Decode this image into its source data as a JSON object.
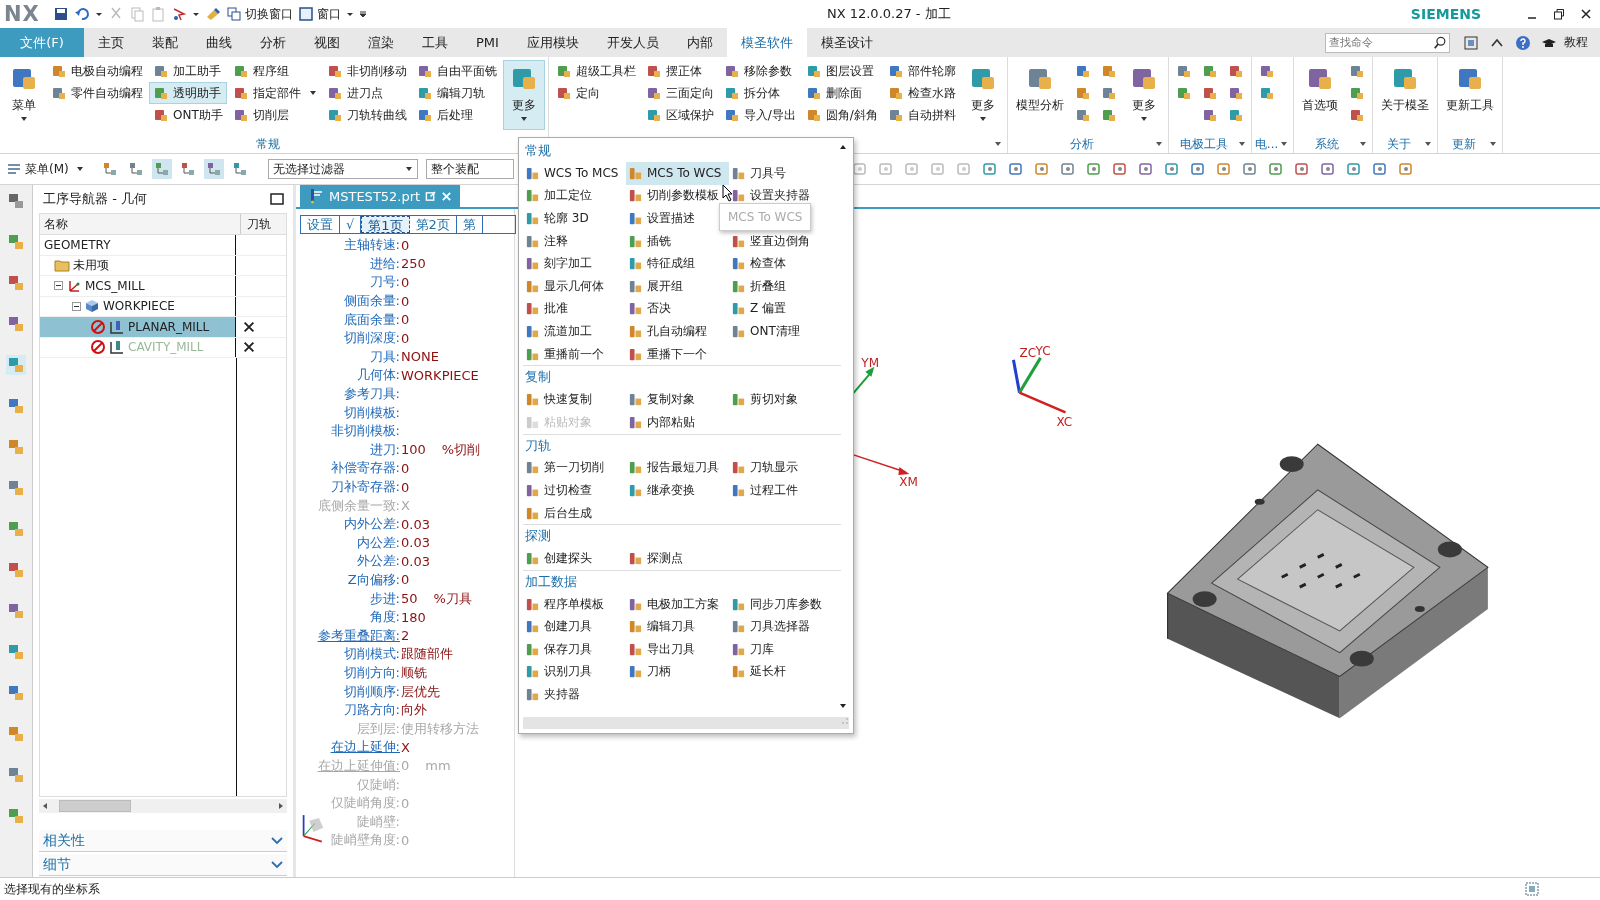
{
  "titlebar": {
    "logo": "NX",
    "quick": [
      "切换窗口",
      "窗口"
    ],
    "title": "NX 12.0.0.27 - 加工",
    "brand": "SIEMENS"
  },
  "tabs": {
    "file": "文件(F)",
    "items": [
      {
        "label": "主页",
        "selected": false
      },
      {
        "label": "装配",
        "selected": false
      },
      {
        "label": "曲线",
        "selected": false
      },
      {
        "label": "分析",
        "selected": false
      },
      {
        "label": "视图",
        "selected": false
      },
      {
        "label": "渲染",
        "selected": false
      },
      {
        "label": "工具",
        "selected": false
      },
      {
        "label": "PMI",
        "selected": false
      },
      {
        "label": "应用模块",
        "selected": false
      },
      {
        "label": "开发人员",
        "selected": false
      },
      {
        "label": "内部",
        "selected": false
      },
      {
        "label": "模圣软件",
        "selected": true
      },
      {
        "label": "模圣设计",
        "selected": false
      }
    ],
    "search": {
      "placeholder": "查找命令"
    },
    "help": "教程"
  },
  "ribbon": {
    "groups": [
      {
        "label": "常规",
        "launcher": false,
        "controls": [
          {
            "kind": "big",
            "label": "菜单",
            "dropdown": true,
            "pressed": false
          },
          {
            "kind": "stack",
            "items": [
              {
                "label": "电极自动编程",
                "highlighted": false,
                "dropdown": false
              },
              {
                "label": "零件自动编程",
                "highlighted": false,
                "dropdown": false
              }
            ]
          },
          {
            "kind": "stack",
            "items": [
              {
                "label": "加工助手",
                "highlighted": false,
                "dropdown": false
              },
              {
                "label": "透明助手",
                "highlighted": true,
                "dropdown": false
              },
              {
                "label": "ONT助手",
                "highlighted": false,
                "dropdown": false
              }
            ]
          },
          {
            "kind": "stack",
            "items": [
              {
                "label": "程序组",
                "highlighted": false,
                "dropdown": false
              },
              {
                "label": "指定部件",
                "highlighted": false,
                "dropdown": true
              },
              {
                "label": "切削层",
                "highlighted": false,
                "dropdown": false
              }
            ]
          },
          {
            "kind": "stack",
            "items": [
              {
                "label": "非切削移动",
                "highlighted": false,
                "dropdown": false
              },
              {
                "label": "进刀点",
                "highlighted": false,
                "dropdown": false
              },
              {
                "label": "刀轨转曲线",
                "highlighted": false,
                "dropdown": false
              }
            ]
          },
          {
            "kind": "stack",
            "items": [
              {
                "label": "自由平面铣",
                "highlighted": false,
                "dropdown": false
              },
              {
                "label": "编辑刀轨",
                "highlighted": false,
                "dropdown": false
              },
              {
                "label": "后处理",
                "highlighted": false,
                "dropdown": false
              }
            ]
          },
          {
            "kind": "big",
            "label": "更多",
            "dropdown": true,
            "pressed": true
          }
        ]
      },
      {
        "launcher": true,
        "controls": [
          {
            "kind": "stack",
            "items": [
              {
                "label": "超级工具栏",
                "highlighted": false,
                "dropdown": false
              },
              {
                "label": "定向",
                "highlighted": false,
                "dropdown": false
              }
            ]
          },
          {
            "kind": "stack",
            "items": [
              {
                "label": "摆正体",
                "highlighted": false,
                "dropdown": false
              },
              {
                "label": "三面定向",
                "highlighted": false,
                "dropdown": false
              },
              {
                "label": "区域保护",
                "highlighted": false,
                "dropdown": false
              }
            ]
          },
          {
            "kind": "stack",
            "items": [
              {
                "label": "移除参数",
                "highlighted": false,
                "dropdown": false
              },
              {
                "label": "拆分体",
                "highlighted": false,
                "dropdown": false
              },
              {
                "label": "导入/导出",
                "highlighted": false,
                "dropdown": false
              }
            ]
          },
          {
            "kind": "stack",
            "items": [
              {
                "label": "图层设置",
                "highlighted": false,
                "dropdown": false
              },
              {
                "label": "删除面",
                "highlighted": false,
                "dropdown": false
              },
              {
                "label": "圆角/斜角",
                "highlighted": false,
                "dropdown": false
              }
            ]
          },
          {
            "kind": "stack",
            "items": [
              {
                "label": "部件轮廓",
                "highlighted": false,
                "dropdown": false
              },
              {
                "label": "检查水路",
                "highlighted": false,
                "dropdown": false
              },
              {
                "label": "自动拼料",
                "highlighted": false,
                "dropdown": false
              }
            ]
          },
          {
            "kind": "big",
            "label": "更多",
            "dropdown": true,
            "pressed": false
          }
        ]
      },
      {
        "label": "分析",
        "launcher": true,
        "controls": [
          {
            "kind": "big",
            "label": "模型分析",
            "dropdown": false,
            "pressed": false
          },
          {
            "kind": "stack",
            "items": [
              {
                "highlighted": false,
                "dropdown": false
              },
              {
                "highlighted": false,
                "dropdown": false
              },
              {
                "highlighted": false,
                "dropdown": false
              }
            ]
          },
          {
            "kind": "stack",
            "items": [
              {
                "highlighted": false,
                "dropdown": false
              },
              {
                "highlighted": false,
                "dropdown": false
              },
              {
                "highlighted": false,
                "dropdown": false
              }
            ]
          },
          {
            "kind": "big",
            "label": "更多",
            "dropdown": true,
            "pressed": false
          }
        ]
      },
      {
        "label": "电极工具",
        "launcher": true,
        "controls": [
          {
            "kind": "stack",
            "items": [
              {
                "highlighted": false,
                "dropdown": false
              },
              {
                "highlighted": false,
                "dropdown": false
              }
            ]
          },
          {
            "kind": "stack",
            "items": [
              {
                "highlighted": false,
                "dropdown": false
              },
              {
                "highlighted": false,
                "dropdown": false
              },
              {
                "highlighted": false,
                "dropdown": false
              }
            ]
          },
          {
            "kind": "stack",
            "items": [
              {
                "highlighted": false,
                "dropdown": false
              },
              {
                "highlighted": false,
                "dropdown": false
              },
              {
                "highlighted": false,
                "dropdown": false
              }
            ]
          }
        ]
      },
      {
        "label": "电...",
        "launcher": true,
        "controls": [
          {
            "kind": "stack",
            "items": [
              {
                "highlighted": false,
                "dropdown": false
              },
              {
                "highlighted": false,
                "dropdown": false
              }
            ]
          }
        ]
      },
      {
        "label": "系统",
        "launcher": true,
        "controls": [
          {
            "kind": "big",
            "label": "首选项",
            "dropdown": false,
            "pressed": false
          },
          {
            "kind": "stack",
            "items": [
              {
                "highlighted": false,
                "dropdown": false
              },
              {
                "highlighted": false,
                "dropdown": false
              },
              {
                "highlighted": false,
                "dropdown": false
              }
            ]
          }
        ]
      },
      {
        "label": "关于",
        "launcher": true,
        "controls": [
          {
            "kind": "big",
            "label": "关于模圣",
            "dropdown": false,
            "pressed": false
          }
        ]
      },
      {
        "label": "更新",
        "launcher": true,
        "controls": [
          {
            "kind": "big",
            "label": "更新工具",
            "dropdown": false,
            "pressed": false
          }
        ]
      }
    ]
  },
  "toolbar": {
    "menu": "菜单(M)",
    "filter": "无选择过滤器",
    "scope": "整个装配"
  },
  "navigator": {
    "title": "工序导航器 - 几何",
    "columns": [
      "名称",
      "刀轨"
    ],
    "root": "GEOMETRY",
    "tree": [
      {
        "label": "未用项",
        "kind": "folder",
        "selected": false,
        "dimmed": false
      },
      {
        "label": "MCS_MILL",
        "kind": "mcs",
        "selected": false,
        "dimmed": false,
        "expanded": true,
        "children": [
          {
            "label": "WORKPIECE",
            "kind": "workpiece",
            "selected": false,
            "dimmed": false,
            "expanded": true,
            "children": [
              {
                "label": "PLANAR_MILL",
                "kind": "operation",
                "selected": true,
                "dimmed": false,
                "toolpath_ok": false
              },
              {
                "label": "CAVITY_MILL",
                "kind": "operation",
                "selected": false,
                "dimmed": true,
                "toolpath_ok": false
              }
            ]
          }
        ]
      }
    ],
    "sections": [
      "相关性",
      "细节"
    ]
  },
  "part_tab": {
    "label": "MSTEST52.prt"
  },
  "params": {
    "tabs": [
      {
        "label": "设置",
        "selected": false
      },
      {
        "label": "√",
        "selected": false
      },
      {
        "label": "第1页",
        "selected": true
      },
      {
        "label": "第2页",
        "selected": false
      },
      {
        "label": "第",
        "selected": false
      }
    ],
    "rows": [
      {
        "label": "主轴转速:",
        "value": "0",
        "disabled": false,
        "link": false
      },
      {
        "label": "进给:",
        "value": "250",
        "disabled": false,
        "link": false
      },
      {
        "label": "刀号:",
        "value": "0",
        "disabled": false,
        "link": false
      },
      {
        "label": "侧面余量:",
        "value": "0",
        "disabled": false,
        "link": false
      },
      {
        "label": "底面余量:",
        "value": "0",
        "disabled": false,
        "link": false
      },
      {
        "label": "切削深度:",
        "value": "0",
        "disabled": false,
        "link": false
      },
      {
        "label": "刀具:",
        "value": "NONE",
        "disabled": false,
        "link": false
      },
      {
        "label": "几何体:",
        "value": "WORKPIECE",
        "disabled": false,
        "link": false
      },
      {
        "label": "参考刀具:",
        "disabled": false,
        "link": false
      },
      {
        "label": "切削模板:",
        "disabled": false,
        "link": false
      },
      {
        "label": "非切削模板:",
        "disabled": false,
        "link": false
      },
      {
        "label": "进刀:",
        "value": "100",
        "unit": "%切削",
        "disabled": false,
        "link": false
      },
      {
        "label": "补偿寄存器:",
        "value": "0",
        "disabled": false,
        "link": false
      },
      {
        "label": "刀补寄存器:",
        "value": "0",
        "disabled": false,
        "link": false
      },
      {
        "label": "底侧余量一致:",
        "value": "X",
        "disabled": true,
        "link": false
      },
      {
        "label": "内外公差:",
        "value": "0.03",
        "disabled": false,
        "link": false
      },
      {
        "label": "内公差:",
        "value": "0.03",
        "disabled": false,
        "link": false
      },
      {
        "label": "外公差:",
        "value": "0.03",
        "disabled": false,
        "link": false
      },
      {
        "label": "Z向偏移:",
        "value": "0",
        "disabled": false,
        "link": false
      },
      {
        "label": "步进:",
        "value": "50",
        "unit": "%刀具",
        "disabled": false,
        "link": false
      },
      {
        "label": "角度:",
        "value": "180",
        "disabled": false,
        "link": false
      },
      {
        "label": "参考重叠距离:",
        "value": "2",
        "disabled": false,
        "link": true
      },
      {
        "label": "切削模式:",
        "value": "跟随部件",
        "disabled": false,
        "link": false
      },
      {
        "label": "切削方向:",
        "value": "顺铣",
        "disabled": false,
        "link": false
      },
      {
        "label": "切削顺序:",
        "value": "层优先",
        "disabled": false,
        "link": false
      },
      {
        "label": "刀路方向:",
        "value": "向外",
        "disabled": false,
        "link": false
      },
      {
        "label": "层到层:",
        "value": "使用转移方法",
        "disabled": true,
        "link": false
      },
      {
        "label": "在边上延伸:",
        "value": "X",
        "disabled": false,
        "link": true
      },
      {
        "label": "在边上延伸值:",
        "value": "0",
        "unit": "mm",
        "disabled": true,
        "link": true
      },
      {
        "label": "仅陡峭:",
        "disabled": true,
        "link": false
      },
      {
        "label": "仅陡峭角度:",
        "value": "0",
        "disabled": true,
        "link": false
      },
      {
        "label": "陡峭壁:",
        "disabled": true,
        "link": false
      },
      {
        "label": "陡峭壁角度:",
        "value": "0",
        "disabled": true,
        "link": false
      }
    ]
  },
  "menu": {
    "sections": [
      {
        "title": "常规",
        "items": [
          {
            "kind": "item",
            "label": "WCS To MCS",
            "disabled": false,
            "highlighted": false
          },
          {
            "kind": "item",
            "label": "MCS To WCS",
            "disabled": false,
            "highlighted": true
          },
          {
            "kind": "item",
            "label": "刀具号",
            "disabled": false,
            "highlighted": false
          },
          {
            "kind": "item",
            "label": "加工定位",
            "disabled": false,
            "highlighted": false
          },
          {
            "kind": "item",
            "label": "切削参数模板",
            "disabled": false,
            "highlighted": false
          },
          {
            "kind": "item",
            "label": "设置夹持器",
            "disabled": false,
            "highlighted": false
          },
          {
            "kind": "item",
            "label": "轮廓 3D",
            "disabled": false,
            "highlighted": false
          },
          {
            "kind": "item",
            "label": "设置描述",
            "disabled": false,
            "highlighted": false
          },
          {
            "kind": "tooltip",
            "label": "MCS To WCS"
          },
          {
            "kind": "item",
            "label": "注释",
            "disabled": false,
            "highlighted": false
          },
          {
            "kind": "item",
            "label": "插铣",
            "disabled": false,
            "highlighted": false
          },
          {
            "kind": "item",
            "label": "竖直边倒角",
            "disabled": false,
            "highlighted": false
          },
          {
            "kind": "item",
            "label": "刻字加工",
            "disabled": false,
            "highlighted": false
          },
          {
            "kind": "item",
            "label": "特征成组",
            "disabled": false,
            "highlighted": false
          },
          {
            "kind": "item",
            "label": "检查体",
            "disabled": false,
            "highlighted": false
          },
          {
            "kind": "item",
            "label": "显示几何体",
            "disabled": false,
            "highlighted": false
          },
          {
            "kind": "item",
            "label": "展开组",
            "disabled": false,
            "highlighted": false
          },
          {
            "kind": "item",
            "label": "折叠组",
            "disabled": false,
            "highlighted": false
          },
          {
            "kind": "item",
            "label": "批准",
            "disabled": false,
            "highlighted": false
          },
          {
            "kind": "item",
            "label": "否决",
            "disabled": false,
            "highlighted": false
          },
          {
            "kind": "item",
            "label": "Z 偏置",
            "disabled": false,
            "highlighted": false
          },
          {
            "kind": "item",
            "label": "流道加工",
            "disabled": false,
            "highlighted": false
          },
          {
            "kind": "item",
            "label": "孔自动编程",
            "disabled": false,
            "highlighted": false
          },
          {
            "kind": "item",
            "label": "ONT清理",
            "disabled": false,
            "highlighted": false
          },
          {
            "kind": "item",
            "label": "重播前一个",
            "disabled": false,
            "highlighted": false
          },
          {
            "kind": "item",
            "label": "重播下一个",
            "disabled": false,
            "highlighted": false
          }
        ]
      },
      {
        "title": "复制",
        "items": [
          {
            "kind": "item",
            "label": "快速复制",
            "disabled": false,
            "highlighted": false
          },
          {
            "kind": "item",
            "label": "复制对象",
            "disabled": false,
            "highlighted": false
          },
          {
            "kind": "item",
            "label": "剪切对象",
            "disabled": false,
            "highlighted": false
          },
          {
            "kind": "item",
            "label": "粘贴对象",
            "disabled": true,
            "highlighted": false
          },
          {
            "kind": "item",
            "label": "内部粘贴",
            "disabled": false,
            "highlighted": false
          }
        ]
      },
      {
        "title": "刀轨",
        "items": [
          {
            "kind": "item",
            "label": "第一刀切削",
            "disabled": false,
            "highlighted": false
          },
          {
            "kind": "item",
            "label": "报告最短刀具",
            "disabled": false,
            "highlighted": false
          },
          {
            "kind": "item",
            "label": "刀轨显示",
            "disabled": false,
            "highlighted": false
          },
          {
            "kind": "item",
            "label": "过切检查",
            "disabled": false,
            "highlighted": false
          },
          {
            "kind": "item",
            "label": "继承变换",
            "disabled": false,
            "highlighted": false
          },
          {
            "kind": "item",
            "label": "过程工件",
            "disabled": false,
            "highlighted": false
          },
          {
            "kind": "item",
            "label": "后台生成",
            "disabled": false,
            "highlighted": false
          }
        ]
      },
      {
        "title": "探测",
        "items": [
          {
            "kind": "item",
            "label": "创建探头",
            "disabled": false,
            "highlighted": false
          },
          {
            "kind": "item",
            "label": "探测点",
            "disabled": false,
            "highlighted": false
          }
        ]
      },
      {
        "title": "加工数据",
        "items": [
          {
            "kind": "item",
            "label": "程序单模板",
            "disabled": false,
            "highlighted": false
          },
          {
            "kind": "item",
            "label": "电极加工方案",
            "disabled": false,
            "highlighted": false
          },
          {
            "kind": "item",
            "label": "同步刀库参数",
            "disabled": false,
            "highlighted": false
          },
          {
            "kind": "item",
            "label": "创建刀具",
            "disabled": false,
            "highlighted": false
          },
          {
            "kind": "item",
            "label": "编辑刀具",
            "disabled": false,
            "highlighted": false
          },
          {
            "kind": "item",
            "label": "刀具选择器",
            "disabled": false,
            "highlighted": false
          },
          {
            "kind": "item",
            "label": "保存刀具",
            "disabled": false,
            "highlighted": false
          },
          {
            "kind": "item",
            "label": "导出刀具",
            "disabled": false,
            "highlighted": false
          },
          {
            "kind": "item",
            "label": "刀库",
            "disabled": false,
            "highlighted": false
          },
          {
            "kind": "item",
            "label": "识别刀具",
            "disabled": false,
            "highlighted": false
          },
          {
            "kind": "item",
            "label": "刀柄",
            "disabled": false,
            "highlighted": false
          },
          {
            "kind": "item",
            "label": "延长杆",
            "disabled": false,
            "highlighted": false
          },
          {
            "kind": "item",
            "label": "夹持器",
            "disabled": false,
            "highlighted": false
          }
        ]
      }
    ]
  },
  "viewport": {
    "machine_axes": [
      "YM",
      "XM"
    ],
    "wcs_axes": [
      "ZC",
      "YC",
      "XC"
    ]
  },
  "status_bar": {
    "text": "选择现有的坐标系"
  }
}
